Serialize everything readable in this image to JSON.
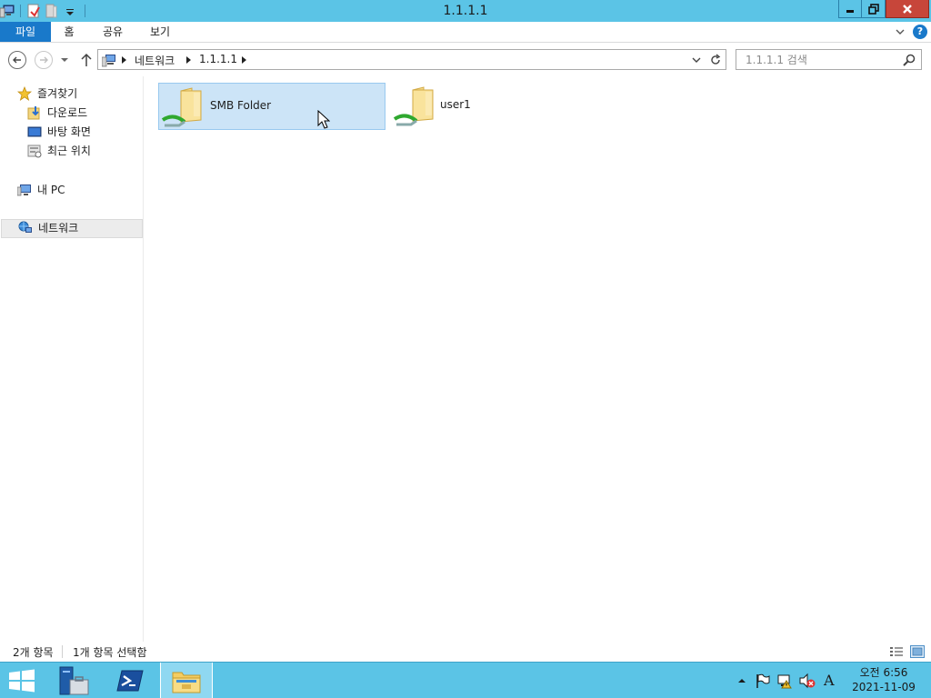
{
  "window": {
    "title": "1.1.1.1"
  },
  "ribbon": {
    "tabs": [
      {
        "label": "파일",
        "active": true
      },
      {
        "label": "홈"
      },
      {
        "label": "공유"
      },
      {
        "label": "보기"
      }
    ]
  },
  "address": {
    "crumbs": [
      "네트워크",
      "1.1.1.1"
    ]
  },
  "search": {
    "placeholder": "1.1.1.1 검색"
  },
  "sidebar": {
    "favorites_label": "즐겨찾기",
    "favorites": [
      "다운로드",
      "바탕 화면",
      "최근 위치"
    ],
    "pc_label": "내 PC",
    "network_label": "네트워크"
  },
  "content": {
    "items": [
      {
        "name": "SMB Folder",
        "selected": true,
        "icon": "network-share-folder-icon"
      },
      {
        "name": "user1",
        "selected": false,
        "icon": "network-share-folder-icon"
      }
    ]
  },
  "status": {
    "count": "2개 항목",
    "selected": "1개 항목 선택함"
  },
  "taskbar": {
    "clock_period_time": "오전 6:56",
    "date": "2021-11-09",
    "ime": "A"
  },
  "colors": {
    "accent": "#1979ca",
    "titlebar": "#5bc4e6",
    "selection": "#cce4f7",
    "close": "#c7463a"
  }
}
